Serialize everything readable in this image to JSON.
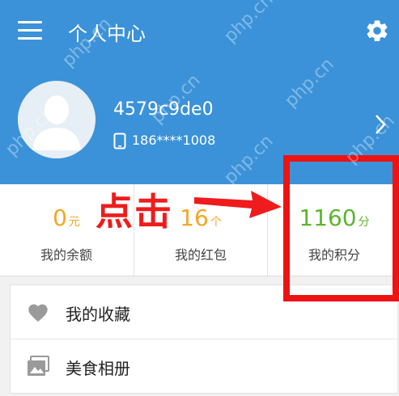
{
  "header": {
    "title": "个人中心",
    "background_color": "#3b92d8"
  },
  "profile": {
    "username": "4579c9de0",
    "phone": "186****1008"
  },
  "stats": [
    {
      "value": "0",
      "unit": "元",
      "label": "我的余额",
      "color": "#f5a623"
    },
    {
      "value": "16",
      "unit": "个",
      "label": "我的红包",
      "color": "#f5a623"
    },
    {
      "value": "1160",
      "unit": "分",
      "label": "我的积分",
      "color": "#5cb531"
    }
  ],
  "list": [
    {
      "label": "我的收藏",
      "icon": "heart-icon"
    },
    {
      "label": "美食相册",
      "icon": "gallery-icon"
    }
  ],
  "annotation": {
    "text": "点击",
    "color": "#ee1c1c"
  },
  "watermark": "php.cn"
}
